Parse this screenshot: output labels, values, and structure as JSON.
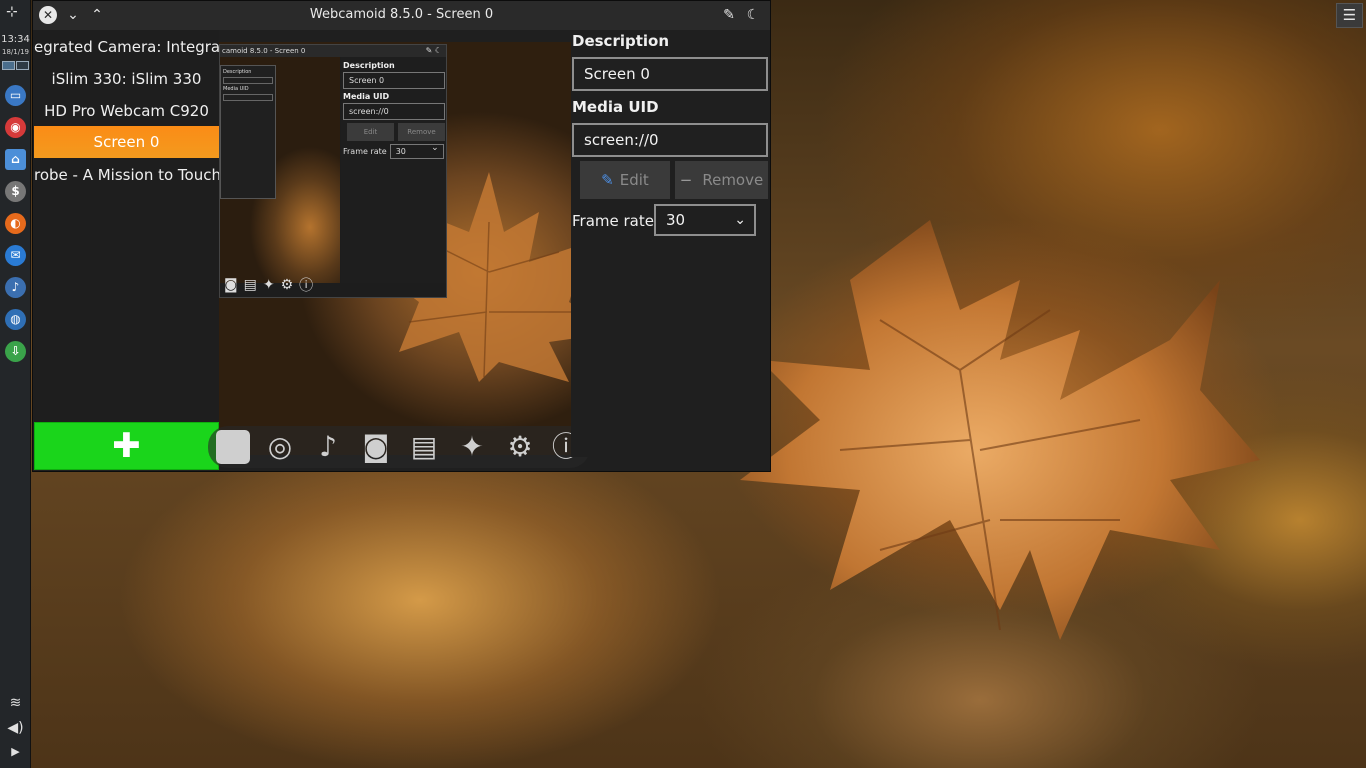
{
  "desktop": {
    "clock_time": "13:34",
    "clock_date": "18/1/19",
    "menu_icon": "hamburger-menu-icon"
  },
  "taskbar": {
    "launchers": [
      {
        "icon": "app-launcher-icon",
        "color": "#d0d0d0"
      },
      {
        "icon": "display-icon",
        "color": "#3a78c4"
      },
      {
        "icon": "record-icon",
        "color": "#d63a3a"
      },
      {
        "icon": "home-folder-icon",
        "color": "#4c8fd8"
      },
      {
        "icon": "terminal-icon",
        "color": "#777777"
      },
      {
        "icon": "firefox-icon",
        "color": "#e66a1c"
      },
      {
        "icon": "thunderbird-icon",
        "color": "#2a7bd4"
      },
      {
        "icon": "music-icon",
        "color": "#3b6fb0"
      },
      {
        "icon": "browser-icon",
        "color": "#2f6fb5"
      },
      {
        "icon": "download-icon",
        "color": "#3aa34a"
      }
    ],
    "system": [
      "wifi-icon",
      "volume-icon",
      "expand-arrow-icon"
    ]
  },
  "window": {
    "title": "Webcamoid 8.5.0 - Screen 0",
    "titlebar_icons": [
      "close-icon",
      "minimize-icon",
      "maximize-icon",
      "pin-icon",
      "night-mode-icon"
    ]
  },
  "devices": {
    "items": [
      {
        "label": "egrated Camera: Integrate",
        "selected": false
      },
      {
        "label": "iSlim 330: iSlim 330",
        "selected": false
      },
      {
        "label": "HD Pro Webcam C920",
        "selected": false
      },
      {
        "label": "Screen 0",
        "selected": true
      },
      {
        "label": "robe - A Mission to Touch t",
        "selected": false
      }
    ],
    "add_label": "✚",
    "selected_color": "#f7931e",
    "add_color": "#1ad51b"
  },
  "preview": {
    "nested_title": "camoid 8.5.0 - Screen 0",
    "nested_description_label": "Description",
    "nested_description_value": "Screen 0",
    "nested_uid_label": "Media UID",
    "nested_uid_value": "screen://0",
    "nested_edit_label": "Edit",
    "nested_remove_label": "Remove",
    "nested_frame_rate_label": "Frame rate",
    "nested_frame_rate_value": "30"
  },
  "toolbar": {
    "tools": [
      "video-placeholder-icon",
      "webcam-icon",
      "music-note-icon",
      "camera-icon",
      "film-strip-icon",
      "magic-wand-icon",
      "settings-gear-icon",
      "info-icon"
    ]
  },
  "panel": {
    "description_label": "Description",
    "description_value": "Screen 0",
    "uid_label": "Media UID",
    "uid_value": "screen://0",
    "edit_label": "Edit",
    "remove_label": "Remove",
    "frame_rate_label": "Frame rate",
    "frame_rate_value": "30"
  }
}
